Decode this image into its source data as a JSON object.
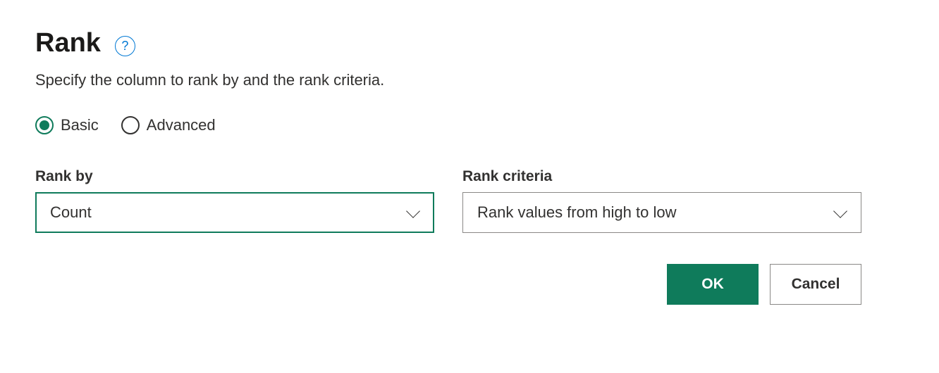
{
  "header": {
    "title": "Rank",
    "subtitle": "Specify the column to rank by and the rank criteria."
  },
  "mode": {
    "options": [
      {
        "label": "Basic",
        "selected": true
      },
      {
        "label": "Advanced",
        "selected": false
      }
    ]
  },
  "fields": {
    "rank_by": {
      "label": "Rank by",
      "value": "Count"
    },
    "rank_criteria": {
      "label": "Rank criteria",
      "value": "Rank values from high to low"
    }
  },
  "buttons": {
    "ok": "OK",
    "cancel": "Cancel"
  }
}
